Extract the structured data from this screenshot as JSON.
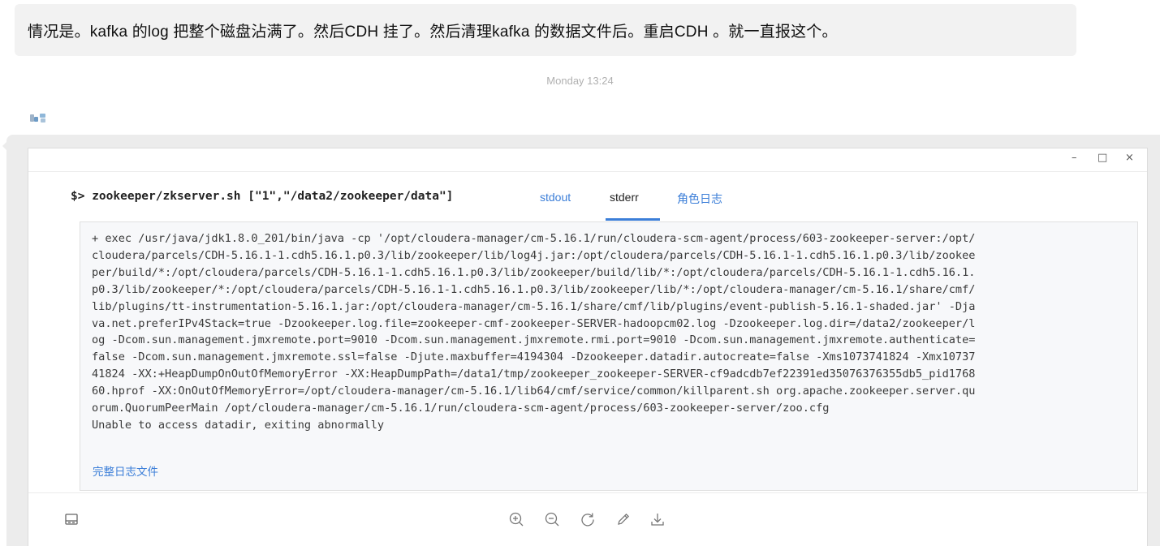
{
  "chat": {
    "message_text": "情况是。kafka 的log 把整个磁盘沾满了。然后CDH 挂了。然后清理kafka 的数据文件后。重启CDH 。就一直报这个。",
    "timestamp": "Monday 13:24"
  },
  "dialog": {
    "window_controls": {
      "minimize": "–",
      "maximize": "□",
      "close": "×"
    },
    "command": "$> zookeeper/zkserver.sh [\"1\",\"/data2/zookeeper/data\"]",
    "tabs": [
      {
        "label": "stdout",
        "active": false
      },
      {
        "label": "stderr",
        "active": true
      },
      {
        "label": "角色日志",
        "active": false
      }
    ],
    "log_lines": [
      "+ exec /usr/java/jdk1.8.0_201/bin/java -cp '/opt/cloudera-manager/cm-5.16.1/run/cloudera-scm-agent/process/603-zookeeper-server:/opt/",
      "cloudera/parcels/CDH-5.16.1-1.cdh5.16.1.p0.3/lib/zookeeper/lib/log4j.jar:/opt/cloudera/parcels/CDH-5.16.1-1.cdh5.16.1.p0.3/lib/zookee",
      "per/build/*:/opt/cloudera/parcels/CDH-5.16.1-1.cdh5.16.1.p0.3/lib/zookeeper/build/lib/*:/opt/cloudera/parcels/CDH-5.16.1-1.cdh5.16.1.",
      "p0.3/lib/zookeeper/*:/opt/cloudera/parcels/CDH-5.16.1-1.cdh5.16.1.p0.3/lib/zookeeper/lib/*:/opt/cloudera-manager/cm-5.16.1/share/cmf/",
      "lib/plugins/tt-instrumentation-5.16.1.jar:/opt/cloudera-manager/cm-5.16.1/share/cmf/lib/plugins/event-publish-5.16.1-shaded.jar' -Dja",
      "va.net.preferIPv4Stack=true -Dzookeeper.log.file=zookeeper-cmf-zookeeper-SERVER-hadoopcm02.log -Dzookeeper.log.dir=/data2/zookeeper/l",
      "og -Dcom.sun.management.jmxremote.port=9010 -Dcom.sun.management.jmxremote.rmi.port=9010 -Dcom.sun.management.jmxremote.authenticate=",
      "false -Dcom.sun.management.jmxremote.ssl=false -Djute.maxbuffer=4194304 -Dzookeeper.datadir.autocreate=false -Xms1073741824 -Xmx10737",
      "41824 -XX:+HeapDumpOnOutOfMemoryError -XX:HeapDumpPath=/data1/tmp/zookeeper_zookeeper-SERVER-cf9adcdb7ef22391ed35076376355db5_pid1768",
      "60.hprof -XX:OnOutOfMemoryError=/opt/cloudera-manager/cm-5.16.1/lib64/cmf/service/common/killparent.sh org.apache.zookeeper.server.qu",
      "orum.QuorumPeerMain /opt/cloudera-manager/cm-5.16.1/run/cloudera-scm-agent/process/603-zookeeper-server/zoo.cfg",
      "Unable to access datadir, exiting abnormally"
    ],
    "full_log_link": "完整日志文件"
  },
  "toolbar": {
    "icons": [
      "panel-toggle-icon",
      "zoom-in-icon",
      "zoom-out-icon",
      "rotate-icon",
      "edit-icon",
      "download-icon"
    ]
  },
  "colors": {
    "accent": "#3b7ed8",
    "bubble": "#f2f2f2",
    "log_background": "#f7f8fa"
  }
}
